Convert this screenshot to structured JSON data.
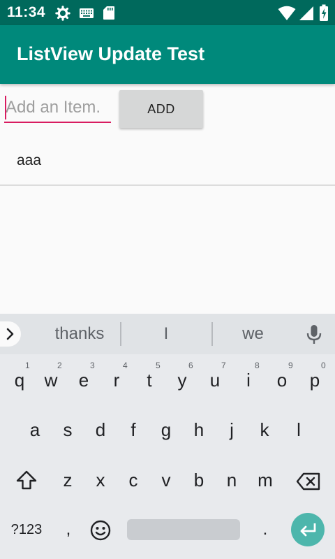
{
  "status_bar": {
    "time": "11:34",
    "icons": [
      "settings-icon",
      "keyboard-icon",
      "sd-card-icon",
      "wifi-icon",
      "signal-icon",
      "battery-icon"
    ]
  },
  "app_bar": {
    "title": "ListView Update Test",
    "color": "#00897b",
    "status_color": "#00695c"
  },
  "form": {
    "input": {
      "placeholder": "Add an Item.",
      "value": ""
    },
    "add_button": "ADD",
    "accent_color": "#d81b60"
  },
  "list": {
    "items": [
      "aaa"
    ]
  },
  "keyboard": {
    "suggestions": [
      "thanks",
      "I",
      "we"
    ],
    "number_hints": [
      "1",
      "2",
      "3",
      "4",
      "5",
      "6",
      "7",
      "8",
      "9",
      "0"
    ],
    "row1": [
      "q",
      "w",
      "e",
      "r",
      "t",
      "y",
      "u",
      "i",
      "o",
      "p"
    ],
    "row2": [
      "a",
      "s",
      "d",
      "f",
      "g",
      "h",
      "j",
      "k",
      "l"
    ],
    "row3": [
      "z",
      "x",
      "c",
      "v",
      "b",
      "n",
      "m"
    ],
    "bottom": {
      "symbols_key": "?123",
      "comma": ",",
      "period": "."
    },
    "icons": [
      "expand-icon",
      "mic-icon",
      "shift-icon",
      "backspace-icon",
      "emoji-icon",
      "enter-icon"
    ],
    "enter_color": "#4db6ac"
  }
}
